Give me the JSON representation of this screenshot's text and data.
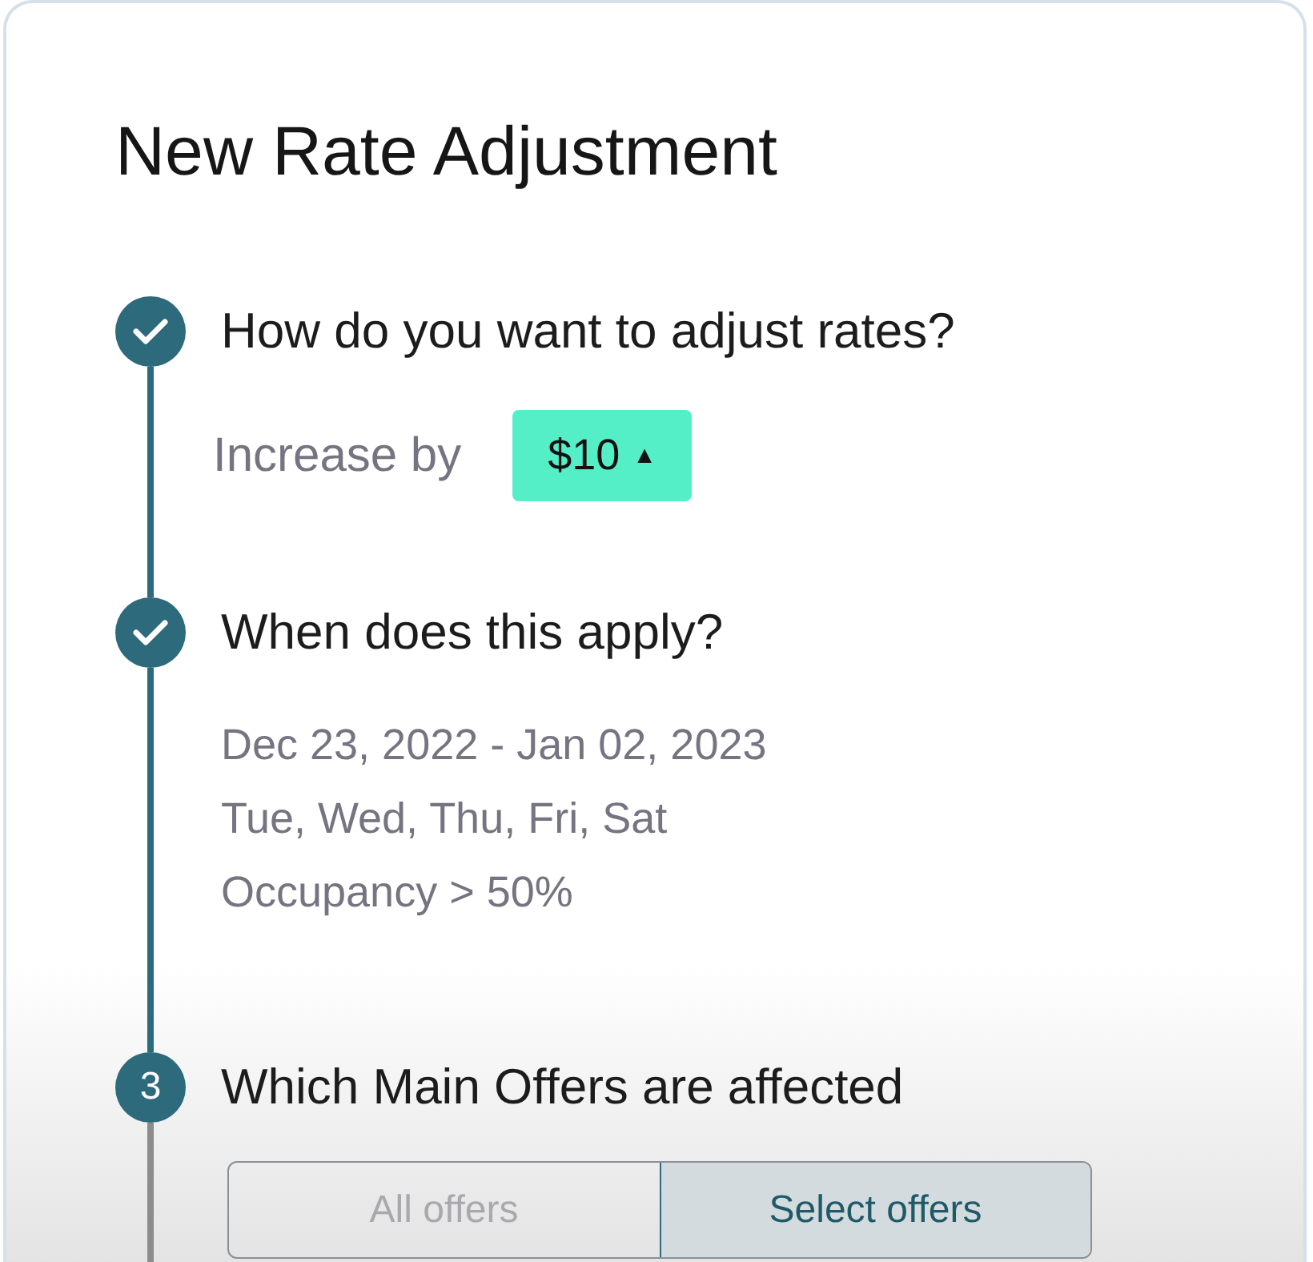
{
  "title": "New Rate Adjustment",
  "steps": [
    {
      "kind": "adjustment",
      "completed": true,
      "title": "How do you want to adjust rates?",
      "label": "Increase by",
      "badge": {
        "value": "$10",
        "caret": "▲"
      }
    },
    {
      "kind": "summary",
      "completed": true,
      "title": "When does this apply?",
      "lines": [
        "Dec 23, 2022 - Jan 02, 2023",
        "Tue, Wed, Thu, Fri, Sat",
        "Occupancy > 50%"
      ]
    },
    {
      "kind": "segments",
      "completed": false,
      "number": "3",
      "title": "Which Main Offers are affected",
      "options": [
        {
          "label": "All offers",
          "selected": false
        },
        {
          "label": "Select offers",
          "selected": true
        }
      ]
    }
  ]
}
